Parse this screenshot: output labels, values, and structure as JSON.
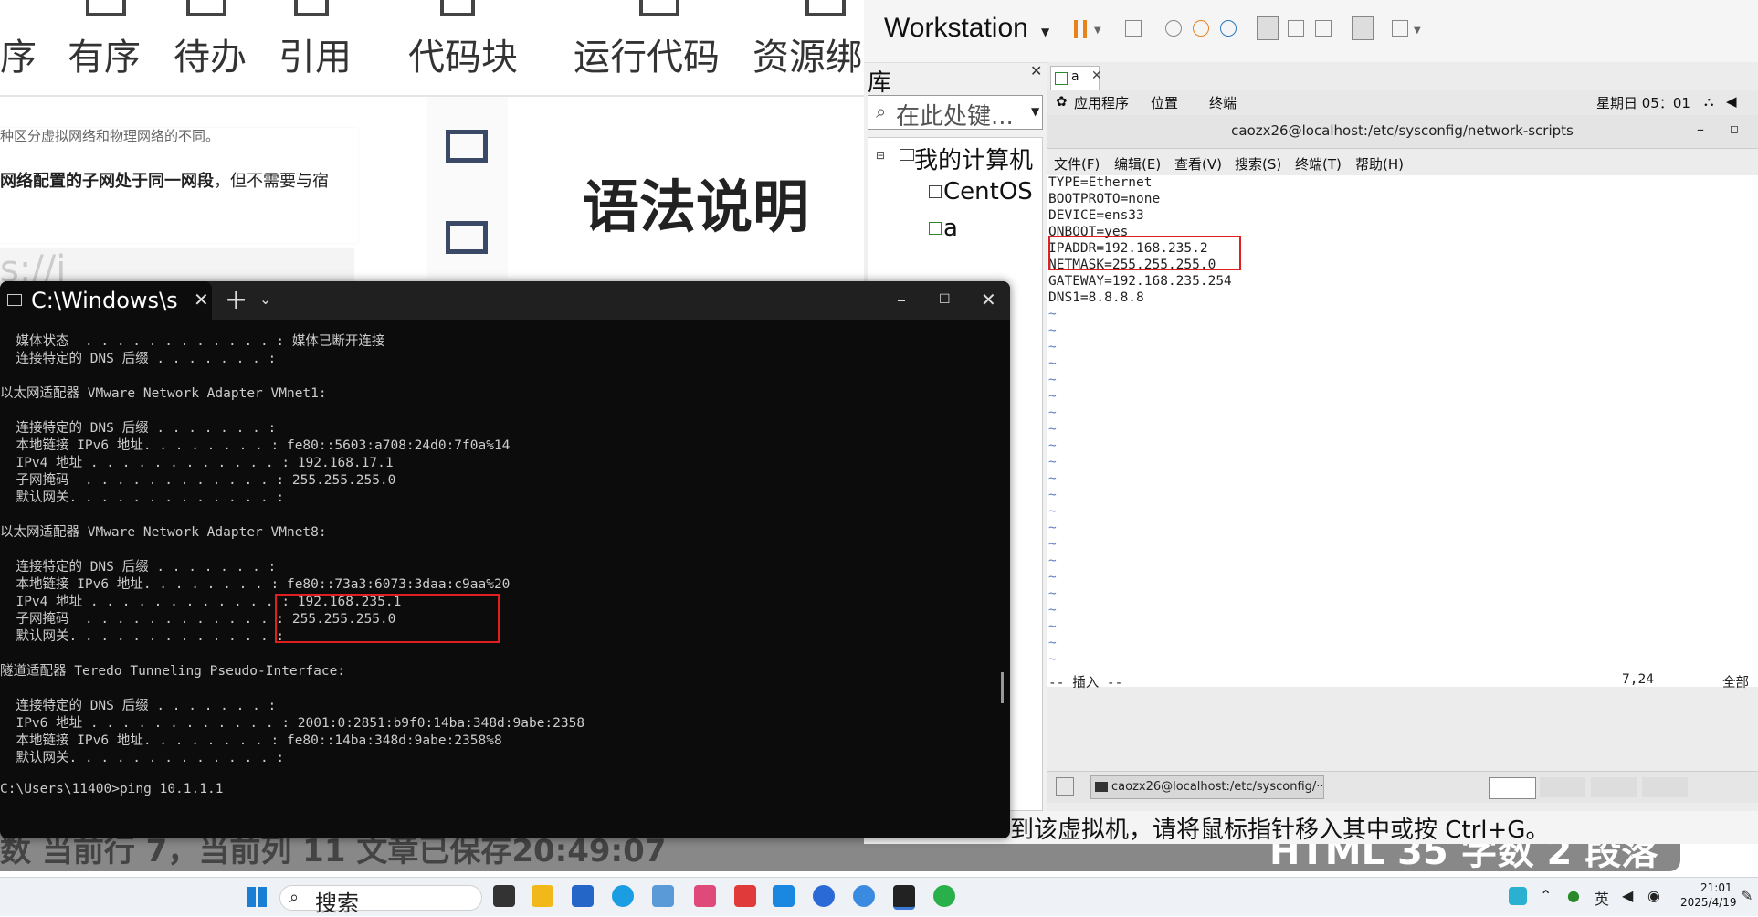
{
  "editor": {
    "toolbar": [
      "序",
      "有序",
      "待办",
      "引用",
      "代码块",
      "运行代码",
      "资源绑"
    ],
    "doc_line1": "种区分虚拟网络和物理网络的不同。",
    "doc_line2_bold": "网络配置的子网处于同一网段",
    "doc_line2_rest": "，但不需要与宿",
    "url_fragment": "s://i",
    "syntax_heading": "语法说明",
    "status_left": "数 当前行 7，当前列 11 文章已保存20:49:07",
    "status_right": "HTML 35 字数 2 段落"
  },
  "terminal": {
    "tab_title": "C:\\Windows\\s",
    "lines": [
      "  媒体状态  . . . . . . . . . . . . : 媒体已断开连接",
      "  连接特定的 DNS 后缀 . . . . . . . :",
      "",
      "以太网适配器 VMware Network Adapter VMnet1:",
      "",
      "  连接特定的 DNS 后缀 . . . . . . . :",
      "  本地链接 IPv6 地址. . . . . . . . : fe80::5603:a708:24d0:7f0a%14",
      "  IPv4 地址 . . . . . . . . . . . . : 192.168.17.1",
      "  子网掩码  . . . . . . . . . . . . : 255.255.255.0",
      "  默认网关. . . . . . . . . . . . . :",
      "",
      "以太网适配器 VMware Network Adapter VMnet8:",
      "",
      "  连接特定的 DNS 后缀 . . . . . . . :",
      "  本地链接 IPv6 地址. . . . . . . . : fe80::73a3:6073:3daa:c9aa%20",
      "  IPv4 地址 . . . . . . . . . . . . : 192.168.235.1",
      "  子网掩码  . . . . . . . . . . . . : 255.255.255.0",
      "  默认网关. . . . . . . . . . . . . :",
      "",
      "隧道适配器 Teredo Tunneling Pseudo-Interface:",
      "",
      "  连接特定的 DNS 后缀 . . . . . . . :",
      "  IPv6 地址 . . . . . . . . . . . . : 2001:0:2851:b9f0:14ba:348d:9abe:2358",
      "  本地链接 IPv6 地址. . . . . . . . : fe80::14ba:348d:9abe:2358%8",
      "  默认网关. . . . . . . . . . . . . :",
      "",
      "C:\\Users\\11400>ping 10.1.1.1"
    ]
  },
  "vmware": {
    "product": "Workstation",
    "library_title": "库",
    "search_placeholder": "在此处键...",
    "tree": [
      "我的计算机",
      "CentOS",
      "a"
    ],
    "hint": "到该虚拟机，请将鼠标指针移入其中或按 Ctrl+G。",
    "guest": {
      "tab": "a",
      "gnome_apps": "应用程序",
      "gnome_places": "位置",
      "gnome_terminal": "终端",
      "clock": "星期日 05：01",
      "window_title": "caozx26@localhost:/etc/sysconfig/network-scripts",
      "menu": [
        "文件(F)",
        "编辑(E)",
        "查看(V)",
        "搜索(S)",
        "终端(T)",
        "帮助(H)"
      ],
      "file_lines": [
        "TYPE=Ethernet",
        "BOOTPROTO=none",
        "DEVICE=ens33",
        "ONBOOT=yes",
        "IPADDR=192.168.235.2",
        "NETMASK=255.255.255.0",
        "GATEWAY=192.168.235.254",
        "DNS1=8.8.8.8"
      ],
      "tilde": "~",
      "mode": "-- 插入 --",
      "cursor_pos": "7,24",
      "scroll": "全部",
      "taskbar_item": "caozx26@localhost:/etc/sysconfig/···"
    }
  },
  "taskbar": {
    "search": "搜索",
    "lang": "英",
    "time": "21:01",
    "date": "2025/4/19"
  }
}
